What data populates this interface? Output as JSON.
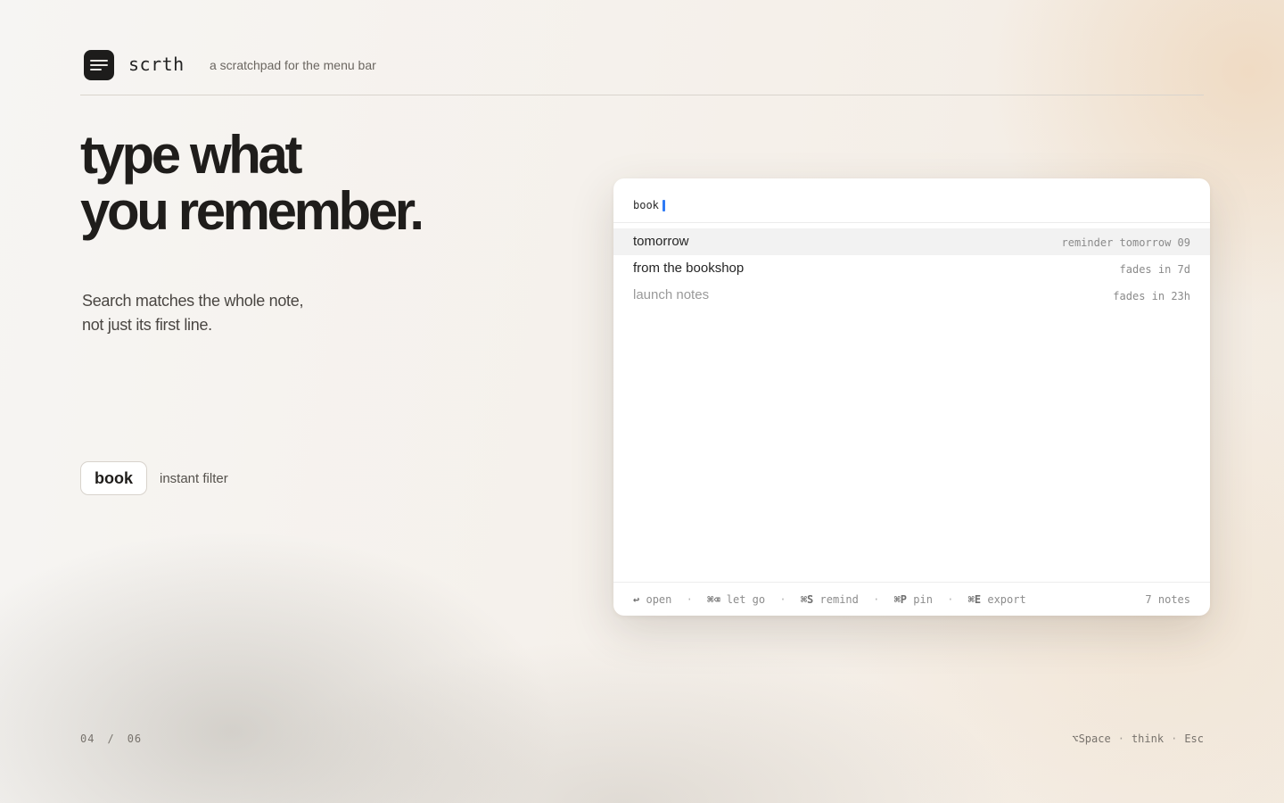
{
  "header": {
    "brand": "scrth",
    "tagline": "a scratchpad for the menu bar",
    "logo_icon": "notepad-lines-icon"
  },
  "hero": {
    "headline_line1": "type what",
    "headline_line2": "you remember.",
    "subtext_line1": "Search matches the whole note,",
    "subtext_line2": "not just its first line."
  },
  "demo": {
    "chip": "book",
    "chip_label": "instant filter"
  },
  "panel": {
    "query": "book",
    "results": [
      {
        "title": "tomorrow",
        "meta": "reminder tomorrow 09",
        "selected": true
      },
      {
        "title": "from the bookshop",
        "meta": "fades in 7d",
        "selected": false
      },
      {
        "title": "launch notes",
        "meta": "fades in 23h",
        "selected": false
      }
    ],
    "footer": {
      "shortcuts": [
        {
          "key": "↩",
          "action": "open"
        },
        {
          "key": "⌘⌫",
          "action": "let go"
        },
        {
          "key": "⌘S",
          "action": "remind"
        },
        {
          "key": "⌘P",
          "action": "pin"
        },
        {
          "key": "⌘E",
          "action": "export"
        }
      ],
      "separator": "·",
      "count": "7 notes"
    }
  },
  "pager": {
    "current": "04",
    "separator": "/",
    "total": "06"
  },
  "hint": {
    "parts": [
      "⌥Space",
      "think",
      "Esc"
    ],
    "separator": "·"
  },
  "colors": {
    "accent_caret": "#2f7bf5",
    "logo_bg": "#1d1c1b"
  }
}
